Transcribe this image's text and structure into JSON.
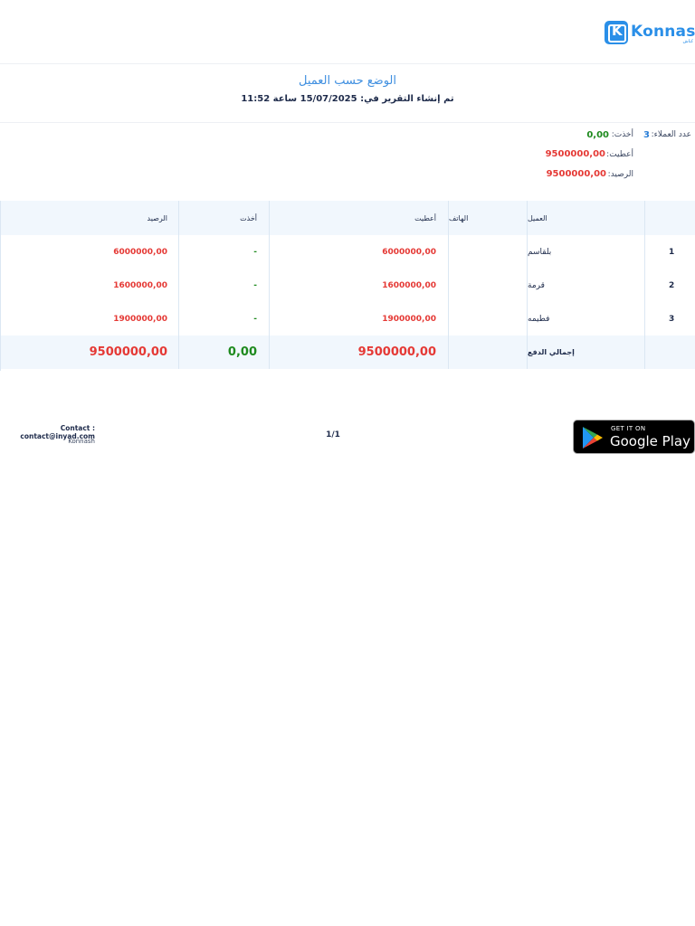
{
  "brand": {
    "name": "Konnash",
    "letter": "K",
    "tagline": "كناش",
    "color": "#2a8fe8"
  },
  "report": {
    "title": "الوضع حسب العميل",
    "created_at": "تم إنشاء التقرير في: 15/07/2025 ساعة 11:52"
  },
  "summary": {
    "clients_label": "عدد العملاء:",
    "clients_count": "3",
    "took_label": "أخذت:",
    "took_value": "0,00",
    "gave_label": "أعطيت:",
    "gave_value": "9500000,00",
    "balance_label": "الرصيد:",
    "balance_value": "9500000,00"
  },
  "table": {
    "headers": {
      "client": "العميل",
      "phone": "الهاتف",
      "gave": "أعطيت",
      "took": "أخذت",
      "balance": "الرصيد"
    },
    "rows": [
      {
        "num": "1",
        "client": "بلقاسم",
        "phone": "",
        "gave": "6000000,00",
        "took": "-",
        "balance": "6000000,00"
      },
      {
        "num": "2",
        "client": "قرمة",
        "phone": "",
        "gave": "1600000,00",
        "took": "-",
        "balance": "1600000,00"
      },
      {
        "num": "3",
        "client": "فطيمه",
        "phone": "",
        "gave": "1900000,00",
        "took": "-",
        "balance": "1900000,00"
      }
    ],
    "total": {
      "label": "إجمالي الدفع",
      "gave": "9500000,00",
      "took": "0,00",
      "balance": "9500000,00"
    }
  },
  "footer": {
    "contact": "Contact : contact@inyad.com",
    "brand": "Konnash",
    "page": "1/1",
    "store_small": "GET IT ON",
    "store_big": "Google Play"
  },
  "colors": {
    "positive": "#1e8a1e",
    "negative": "#e53935",
    "accent": "#3f8fe0"
  }
}
